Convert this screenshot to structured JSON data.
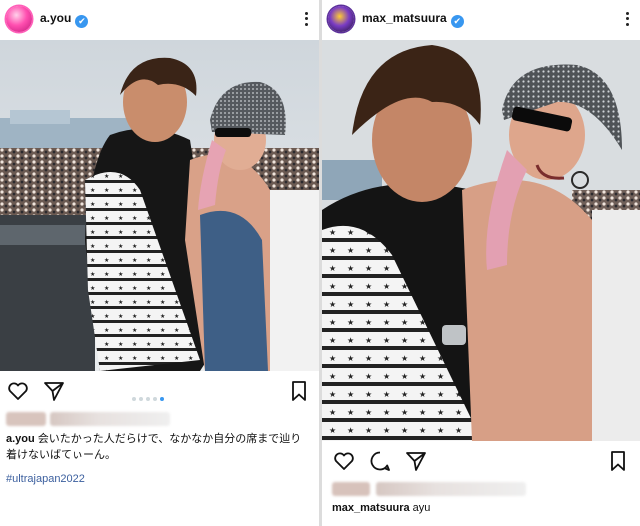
{
  "posts": [
    {
      "username": "a.you",
      "verified_mark": "✔",
      "avatar_icon": "profile-avatar-icon",
      "carousel": {
        "total": 5,
        "active_index": 4
      },
      "caption_user": "a.you",
      "caption_text": "会いたかった人だらけで、なかなか自分の席まで辿り着けないばてぃーん。",
      "hashtag": "#ultrajapan2022"
    },
    {
      "username": "max_matsuura",
      "verified_mark": "✔",
      "avatar_icon": "profile-avatar-icon",
      "caption_user": "max_matsuura",
      "caption_text": "ayu"
    }
  ],
  "icons": {
    "like": "heart-icon",
    "comment": "comment-icon",
    "share": "send-icon",
    "save": "bookmark-icon",
    "more": "more-vertical-icon"
  },
  "colors": {
    "accent": "#3897f0",
    "hashtag": "#3b5f9e",
    "text": "#111111"
  }
}
